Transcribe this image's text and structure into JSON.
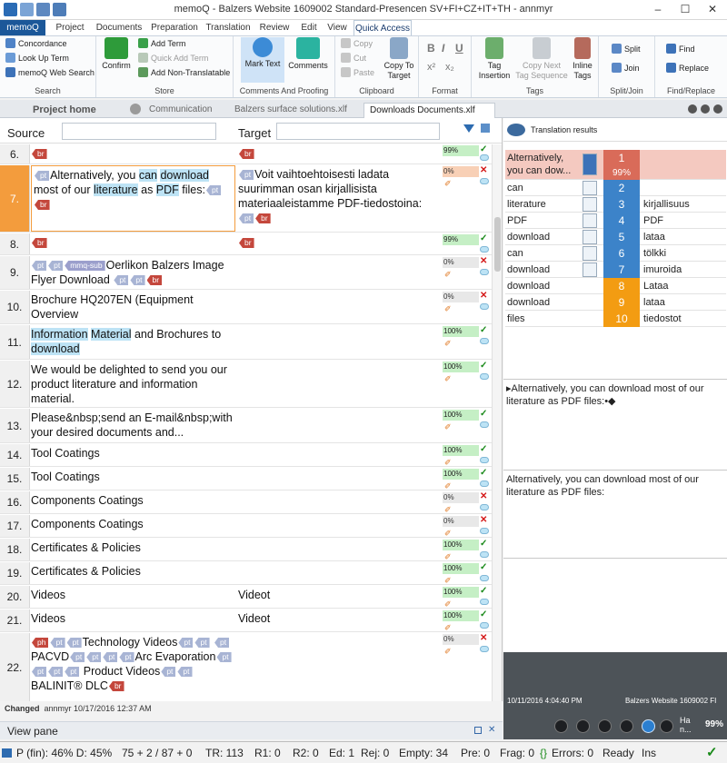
{
  "window": {
    "title": "memoQ - Balzers Website 1609002 Standard-Presencen SV+FI+CZ+IT+TH - annmyr",
    "minimize": "–",
    "maximize": "☐",
    "close": "✕"
  },
  "menu_tabs": [
    "memoQ",
    "Project",
    "Documents",
    "Preparation",
    "Translation",
    "Review",
    "Edit",
    "View",
    "Quick Access"
  ],
  "ribbon": {
    "search": {
      "concordance": "Concordance",
      "look_up_term": "Look Up Term",
      "web_search": "memoQ Web Search",
      "group": "Search"
    },
    "store": {
      "confirm": "Confirm",
      "add_term": "Add Term",
      "quick_add_term": "Quick Add Term",
      "add_non_translatable": "Add Non-Translatable",
      "group": "Store"
    },
    "comments": {
      "mark_text": "Mark Text",
      "comments": "Comments",
      "group": "Comments And Proofing"
    },
    "clipboard": {
      "copy": "Copy",
      "cut": "Cut",
      "paste": "Paste",
      "copy_to_target_1": "Copy To",
      "copy_to_target_2": "Target",
      "group": "Clipboard"
    },
    "format": {
      "bold": "B",
      "italic": "I",
      "underline": "U",
      "superscript": "x²",
      "subscript": "x₂",
      "group": "Format"
    },
    "tags": {
      "tag_insertion_1": "Tag",
      "tag_insertion_2": "Insertion",
      "copy_next_1": "Copy Next",
      "copy_next_2": "Tag Sequence",
      "inline_tags_1": "Inline",
      "inline_tags_2": "Tags",
      "group": "Tags"
    },
    "splitjoin": {
      "split": "Split",
      "join": "Join",
      "group": "Split/Join"
    },
    "findreplace": {
      "find": "Find",
      "replace": "Replace",
      "group": "Find/Replace"
    }
  },
  "doc_tabs": {
    "project_home": "Project home",
    "communication": "Communication",
    "balzers_surface": "Balzers surface solutions.xlf",
    "downloads": "Downloads Documents.xlf"
  },
  "grid": {
    "source_label": "Source",
    "target_label": "Target"
  },
  "rows": [
    {
      "num": "6.",
      "status": "99%"
    },
    {
      "num": "7.",
      "src_1": "Alternatively, you ",
      "src_can": "can",
      "src_2": " ",
      "src_download": "download",
      "src_3": " most of our ",
      "src_literature": "literature",
      "src_4": " as ",
      "src_pdf": "PDF",
      "src_5": " files:",
      "tgt": "Voit vaihtoehtoisesti ladata suurimman osan kirjallisista materiaaleistamme PDF-tiedostoina:",
      "status": "0%"
    },
    {
      "num": "8.",
      "status": "99%"
    },
    {
      "num": "9.",
      "src": "Oerlikon Balzers Image Flyer Download",
      "status": "0%"
    },
    {
      "num": "10.",
      "src": "Brochure HQ207EN (Equipment Overview",
      "status": "0%"
    },
    {
      "num": "11.",
      "src_a": "Information",
      "src_b": " ",
      "src_c": "Material",
      "src_d": " and Brochures to ",
      "src_e": "download",
      "status": "100%"
    },
    {
      "num": "12.",
      "src": "We would be delighted to send you our product literature and information material.",
      "status": "100%"
    },
    {
      "num": "13.",
      "src": "Please&nbsp;send an E-mail&nbsp;with your desired documents and...",
      "status": "100%"
    },
    {
      "num": "14.",
      "src": "Tool Coatings",
      "status": "100%"
    },
    {
      "num": "15.",
      "src": "Tool Coatings",
      "status": "100%"
    },
    {
      "num": "16.",
      "src": "Components Coatings",
      "status": "0%"
    },
    {
      "num": "17.",
      "src": "Components Coatings",
      "status": "0%"
    },
    {
      "num": "18.",
      "src": "Certificates & Policies",
      "status": "100%"
    },
    {
      "num": "19.",
      "src": "Certificates & Policies",
      "status": "100%"
    },
    {
      "num": "20.",
      "src": "Videos",
      "tgt": "Videot",
      "status": "100%"
    },
    {
      "num": "21.",
      "src": "Videos",
      "tgt": "Videot",
      "status": "100%"
    },
    {
      "num": "22.",
      "src_1": "Technology Videos",
      "src_2": "PACVD",
      "src_3": "Arc",
      "src_4": "Evaporation",
      "src_5": "Product Videos",
      "src_6": "BALINIT®",
      "src_7": "DLC",
      "status": "0%"
    }
  ],
  "tags": {
    "br": "br",
    "pt": "pt",
    "mq": "mmq-sub",
    "ph": "ph"
  },
  "status_line": {
    "label": "Changed",
    "value": "annmyr 10/17/2016 12:37 AM"
  },
  "view_pane": "View pane",
  "results": {
    "header": "Translation results",
    "items": [
      {
        "src": "Alternatively, you can dow...",
        "num": "1",
        "pct": "99%",
        "tgt": ""
      },
      {
        "src": "can",
        "num": "2",
        "tgt": ""
      },
      {
        "src": "literature",
        "num": "3",
        "tgt": "kirjallisuus"
      },
      {
        "src": "PDF",
        "num": "4",
        "tgt": "PDF"
      },
      {
        "src": "download",
        "num": "5",
        "tgt": "lataa"
      },
      {
        "src": "can",
        "num": "6",
        "tgt": "tölkki"
      },
      {
        "src": "download",
        "num": "7",
        "tgt": "imuroida"
      },
      {
        "src": "download",
        "num": "8",
        "tgt": "Lataa"
      },
      {
        "src": "download",
        "num": "9",
        "tgt": "lataa"
      },
      {
        "src": "files",
        "num": "10",
        "tgt": "tiedostot"
      }
    ],
    "pane1": "▸Alternatively, you can download most of our literature as PDF files:•◆",
    "pane2": "Alternatively, you can download most of our literature as PDF files:",
    "footer_date": "10/11/2016 4:04:40 PM",
    "footer_project": "Balzers Website 1609002 FI",
    "footer_user": "Ha n...",
    "footer_pct": "99%"
  },
  "statusbar": {
    "progress": "P (fin): 46%  D: 45%",
    "words": "75 + 2 / 87 + 0",
    "tr": "TR: 113",
    "r1": "R1: 0",
    "r2": "R2: 0",
    "ed": "Ed: 1",
    "rej": "Rej: 0",
    "empty": "Empty: 34",
    "pre": "Pre: 0",
    "frag": "Frag: 0",
    "errors": "Errors: 0",
    "ready": "Ready",
    "ins": "Ins"
  }
}
